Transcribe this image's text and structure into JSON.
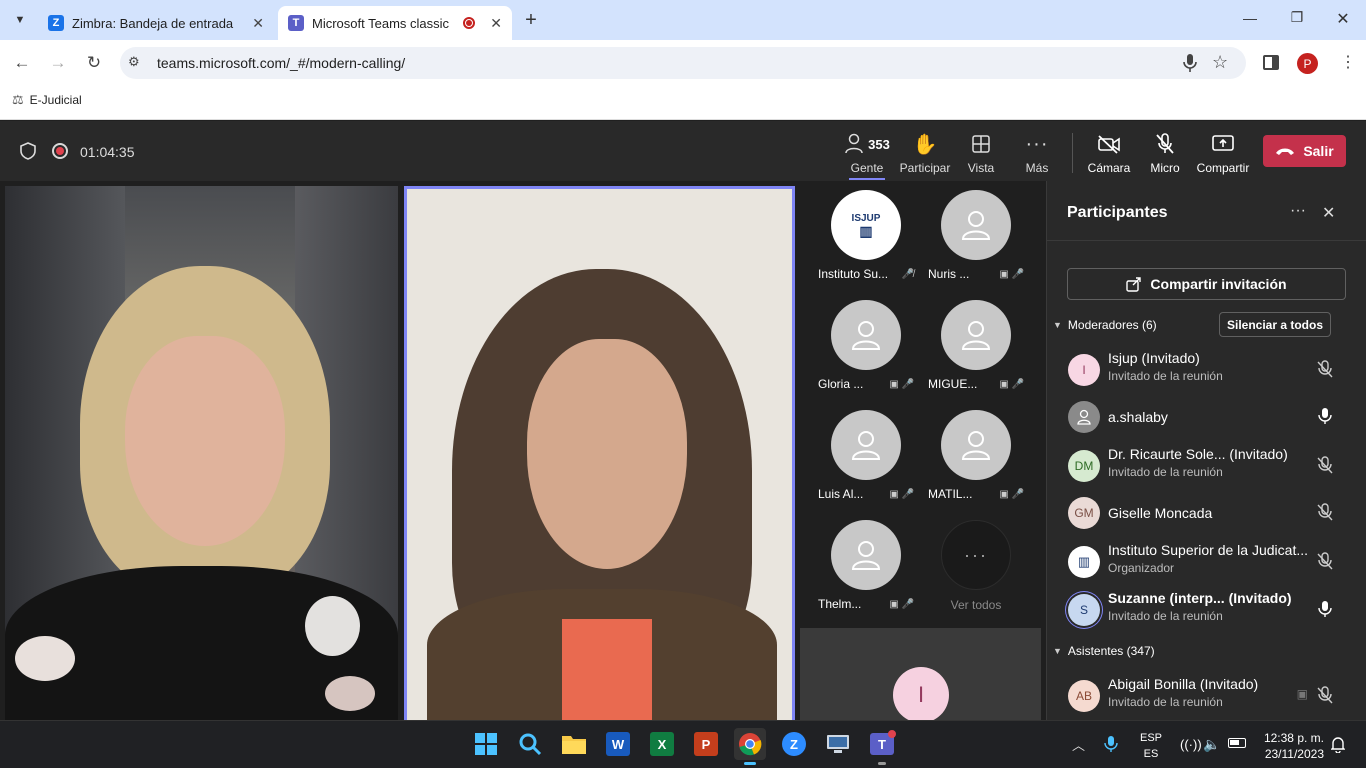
{
  "browser": {
    "tabs": [
      {
        "title": "Zimbra: Bandeja de entrada",
        "favicon": "zimbra-icon"
      },
      {
        "title": "Microsoft Teams classic",
        "favicon": "teams-icon"
      }
    ],
    "url": "teams.microsoft.com/_#/modern-calling/",
    "bookmark": "E-Judicial",
    "profile_initial": "P"
  },
  "meeting": {
    "timer": "01:04:35",
    "people_count": "353",
    "buttons": {
      "people": "Gente",
      "raise": "Participar",
      "view": "Vista",
      "more": "Más",
      "camera": "Cámara",
      "mic": "Micro",
      "share": "Compartir",
      "leave": "Salir"
    }
  },
  "gallery": [
    {
      "name": "Instituto Su...",
      "logo": "ISJUP"
    },
    {
      "name": "Nuris ..."
    },
    {
      "name": "Gloria ..."
    },
    {
      "name": "MIGUE..."
    },
    {
      "name": "Luis Al..."
    },
    {
      "name": "MATIL..."
    },
    {
      "name": "Thelm..."
    },
    {
      "name": "Ver todos"
    }
  ],
  "bottom_tile_initial": "I",
  "panel": {
    "title": "Participantes",
    "share_invite": "Compartir invitación",
    "moderators_header": "Moderadores (6)",
    "mute_all": "Silenciar a todos",
    "attendees_header": "Asistentes (347)",
    "moderators": [
      {
        "initials": "I",
        "name": "Isjup (Invitado)",
        "role": "Invitado de la reunión",
        "color": "#f8d7e4"
      },
      {
        "initials": "",
        "name": "a.shalaby",
        "role": "",
        "color": "#8a8a8a"
      },
      {
        "initials": "DM",
        "name": "Dr. Ricaurte Sole... (Invitado)",
        "role": "Invitado de la reunión",
        "color": "#d6ead0"
      },
      {
        "initials": "GM",
        "name": "Giselle Moncada",
        "role": "",
        "color": "#eadad6"
      },
      {
        "initials": "",
        "name": "Instituto Superior de la Judicat...",
        "role": "Organizador",
        "color": "#ffffff"
      },
      {
        "initials": "S",
        "name": "Suzanne (interp...  (Invitado)",
        "role": "Invitado de la reunión",
        "color": "#c7d8f0"
      }
    ],
    "attendees": [
      {
        "initials": "AB",
        "name": "Abigail Bonilla (Invitado)",
        "role": "Invitado de la reunión",
        "color": "#f5dad0"
      }
    ]
  },
  "taskbar": {
    "lang": "ESP",
    "lang2": "ES",
    "time": "12:38 p. m.",
    "date": "23/11/2023"
  }
}
